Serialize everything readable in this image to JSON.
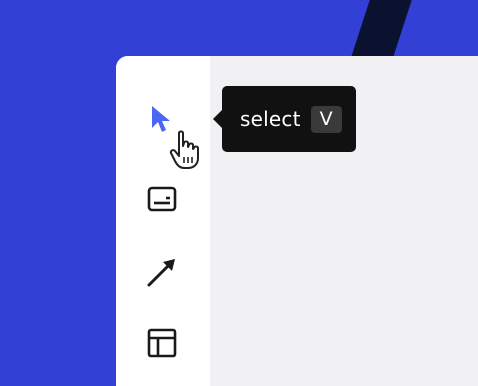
{
  "colors": {
    "backdrop": "#3340d6",
    "stripe": "#0b1230",
    "canvas": "#f1f1f4",
    "toolbar": "#ffffff",
    "active_tool": "#4a67f2",
    "icon": "#1a1a1a",
    "tooltip_bg": "#111111",
    "kbd_bg": "#3a3a3a"
  },
  "toolbar": {
    "tools": [
      {
        "id": "select",
        "icon": "select-arrow-icon",
        "active": true
      },
      {
        "id": "frame",
        "icon": "frame-icon",
        "active": false
      },
      {
        "id": "arrow",
        "icon": "diagonal-arrow-icon",
        "active": false
      },
      {
        "id": "layout",
        "icon": "layout-icon",
        "active": false
      }
    ]
  },
  "tooltip": {
    "label": "select",
    "shortcut": "V"
  },
  "cursor": {
    "icon": "hand-pointer-icon"
  }
}
